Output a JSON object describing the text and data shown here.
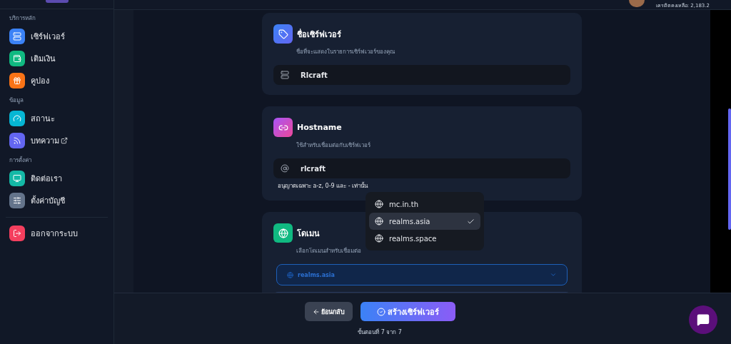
{
  "header": {
    "credit": "เครดิตคงเหลือ: 2,183.2"
  },
  "sidebar": {
    "sections": [
      {
        "title": "บริการหลัก",
        "items": [
          {
            "label": "เซิร์ฟเวอร์",
            "color": "#3b82f6",
            "external": false
          },
          {
            "label": "เติมเงิน",
            "color": "#10b981",
            "external": false
          },
          {
            "label": "คูปอง",
            "color": "#f97316",
            "external": false
          }
        ]
      },
      {
        "title": "ข้อมูล",
        "items": [
          {
            "label": "สถานะ",
            "color": "#06b6d4",
            "external": false
          },
          {
            "label": "บทความ",
            "color": "#6366f1",
            "external": true
          }
        ]
      },
      {
        "title": "การตั้งค่า",
        "items": [
          {
            "label": "ติดต่อเรา",
            "color": "#14b8a6",
            "external": false
          },
          {
            "label": "ตั้งค่าบัญชี",
            "color": "#64748b",
            "external": false
          }
        ]
      }
    ],
    "logout": {
      "label": "ออกจากระบบ",
      "color": "#f43f5e"
    }
  },
  "cards": [
    {
      "kind": "text",
      "title": "ชื่อเซิร์ฟเวอร์",
      "subtitle": "ชื่อที่จะแสดงในรายการเซิร์ฟเวอร์ของคุณ",
      "value": "Rlcraft"
    },
    {
      "kind": "text",
      "title": "Hostname",
      "subtitle": "ใช้สำหรับเชื่อมต่อกับเซิร์ฟเวอร์",
      "value": "rlcraft",
      "hint": "อนุญาตเฉพาะ a-z, 0-9 และ - เท่านั้น"
    },
    {
      "kind": "select",
      "title": "โดเมน",
      "subtitle": "เลือกโดเมนสำหรับเชื่อมต่อ",
      "value": "realms.asia"
    }
  ],
  "dropdown": {
    "options": [
      {
        "label": "mc.in.th",
        "selected": false
      },
      {
        "label": "realms.asia",
        "selected": true
      },
      {
        "label": "realms.space",
        "selected": false
      }
    ]
  },
  "footer": {
    "back": "ย้อนกลับ",
    "create": "สร้างเซิร์ฟเวอร์",
    "step": "ขั้นตอนที่ 7 จาก 7"
  }
}
